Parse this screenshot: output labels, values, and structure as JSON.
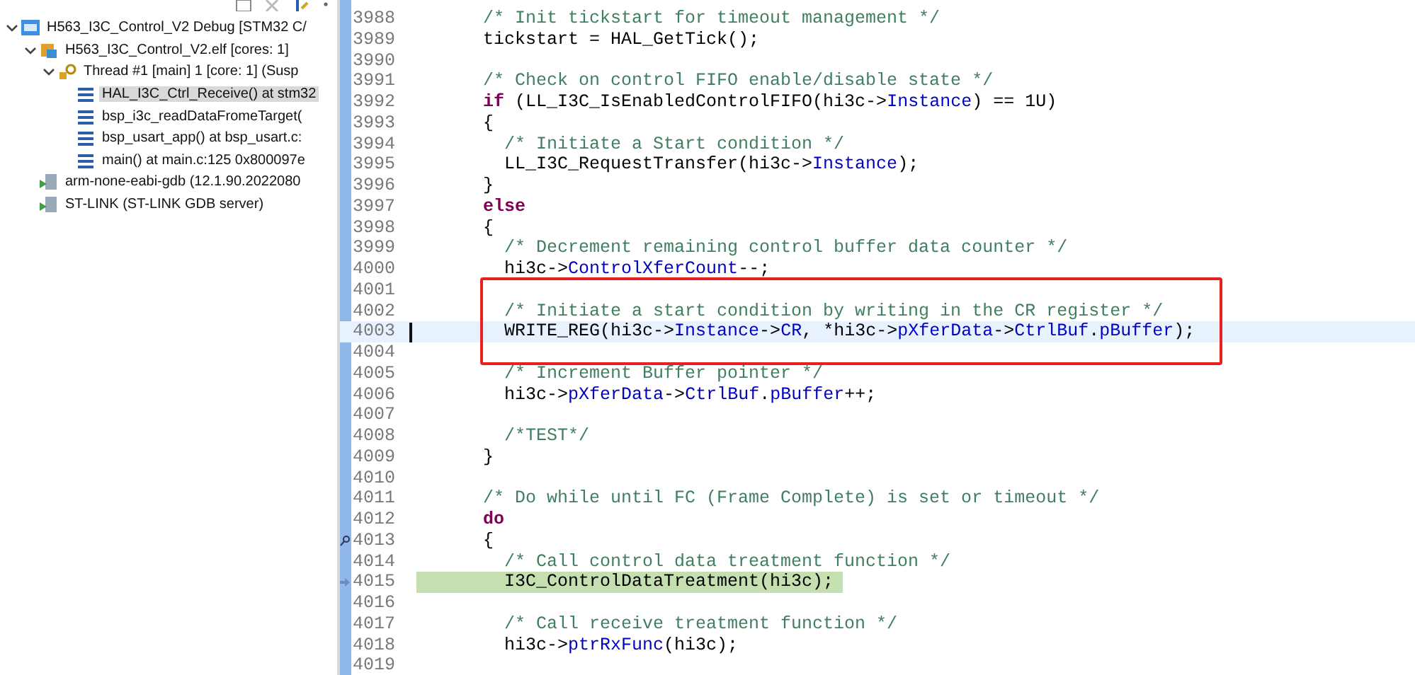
{
  "debug_view": {
    "tree": [
      {
        "kind": "launch",
        "label": "H563_I3C_Control_V2 Debug [STM32 C/",
        "expanded": true,
        "children": [
          {
            "kind": "elf",
            "label": "H563_I3C_Control_V2.elf [cores: 1]",
            "expanded": true,
            "children": [
              {
                "kind": "thread",
                "label": "Thread #1 [main] 1 [core: 1] (Susp",
                "expanded": true,
                "children": [
                  {
                    "kind": "frame",
                    "label": "HAL_I3C_Ctrl_Receive() at stm32",
                    "selected": true
                  },
                  {
                    "kind": "frame",
                    "label": "bsp_i3c_readDataFromeTarget(",
                    "selected": false
                  },
                  {
                    "kind": "frame",
                    "label": "bsp_usart_app() at bsp_usart.c:",
                    "selected": false
                  },
                  {
                    "kind": "frame",
                    "label": "main() at main.c:125 0x800097e",
                    "selected": false
                  }
                ]
              }
            ]
          },
          {
            "kind": "process",
            "label": "arm-none-eabi-gdb (12.1.90.2022080"
          },
          {
            "kind": "process",
            "label": "ST-LINK (ST-LINK GDB server)"
          }
        ]
      }
    ]
  },
  "editor": {
    "lines": [
      {
        "number": "3988",
        "segments": [
          {
            "kind": "comment",
            "text": "      /* Init tickstart for timeout management */"
          }
        ]
      },
      {
        "number": "3989",
        "segments": [
          {
            "kind": "plain",
            "text": "      tickstart = HAL_GetTick();"
          }
        ]
      },
      {
        "number": "3990"
      },
      {
        "number": "3991",
        "segments": [
          {
            "kind": "comment",
            "text": "      /* Check on control FIFO enable/disable state */"
          }
        ]
      },
      {
        "number": "3992",
        "segments": [
          {
            "kind": "keyword",
            "text": "      if"
          },
          {
            "kind": "plain",
            "text": " (LL_I3C_IsEnabledControlFIFO(hi3c->"
          },
          {
            "kind": "field",
            "text": "Instance"
          },
          {
            "kind": "plain",
            "text": ") == 1U)"
          }
        ]
      },
      {
        "number": "3993",
        "segments": [
          {
            "kind": "plain",
            "text": "      {"
          }
        ]
      },
      {
        "number": "3994",
        "segments": [
          {
            "kind": "comment",
            "text": "        /* Initiate a Start condition */"
          }
        ]
      },
      {
        "number": "3995",
        "segments": [
          {
            "kind": "plain",
            "text": "        LL_I3C_RequestTransfer(hi3c->"
          },
          {
            "kind": "field",
            "text": "Instance"
          },
          {
            "kind": "plain",
            "text": ");"
          }
        ]
      },
      {
        "number": "3996",
        "segments": [
          {
            "kind": "plain",
            "text": "      }"
          }
        ]
      },
      {
        "number": "3997",
        "segments": [
          {
            "kind": "keyword",
            "text": "      else"
          }
        ]
      },
      {
        "number": "3998",
        "segments": [
          {
            "kind": "plain",
            "text": "      {"
          }
        ]
      },
      {
        "number": "3999",
        "segments": [
          {
            "kind": "comment",
            "text": "        /* Decrement remaining control buffer data counter */"
          }
        ]
      },
      {
        "number": "4000",
        "segments": [
          {
            "kind": "plain",
            "text": "        hi3c->"
          },
          {
            "kind": "field",
            "text": "ControlXferCount"
          },
          {
            "kind": "plain",
            "text": "--;"
          }
        ]
      },
      {
        "number": "4001",
        "boxed": true
      },
      {
        "number": "4002",
        "boxed": true,
        "segments": [
          {
            "kind": "comment",
            "text": "        /* Initiate a start condition by writing in the CR register */"
          }
        ]
      },
      {
        "number": "4003",
        "boxed": true,
        "current_line": true,
        "segments": [
          {
            "kind": "plain",
            "text": "        WRITE_REG(hi3c->"
          },
          {
            "kind": "field",
            "text": "Instance"
          },
          {
            "kind": "plain",
            "text": "->"
          },
          {
            "kind": "field",
            "text": "CR"
          },
          {
            "kind": "plain",
            "text": ", *hi3c->"
          },
          {
            "kind": "field",
            "text": "pXferData"
          },
          {
            "kind": "plain",
            "text": "->"
          },
          {
            "kind": "field",
            "text": "CtrlBuf"
          },
          {
            "kind": "plain",
            "text": "."
          },
          {
            "kind": "field",
            "text": "pBuffer"
          },
          {
            "kind": "plain",
            "text": ");"
          }
        ]
      },
      {
        "number": "4004",
        "boxed": true
      },
      {
        "number": "4005",
        "segments": [
          {
            "kind": "comment",
            "text": "        /* Increment Buffer pointer */"
          }
        ]
      },
      {
        "number": "4006",
        "segments": [
          {
            "kind": "plain",
            "text": "        hi3c->"
          },
          {
            "kind": "field",
            "text": "pXferData"
          },
          {
            "kind": "plain",
            "text": "->"
          },
          {
            "kind": "field",
            "text": "CtrlBuf"
          },
          {
            "kind": "plain",
            "text": "."
          },
          {
            "kind": "field",
            "text": "pBuffer"
          },
          {
            "kind": "plain",
            "text": "++;"
          }
        ]
      },
      {
        "number": "4007"
      },
      {
        "number": "4008",
        "segments": [
          {
            "kind": "comment",
            "text": "        /*TEST*/"
          }
        ]
      },
      {
        "number": "4009",
        "segments": [
          {
            "kind": "plain",
            "text": "      }"
          }
        ]
      },
      {
        "number": "4010"
      },
      {
        "number": "4011",
        "segments": [
          {
            "kind": "comment",
            "text": "      /* Do while until FC (Frame Complete) is set or timeout */"
          }
        ]
      },
      {
        "number": "4012",
        "segments": [
          {
            "kind": "keyword",
            "text": "      do"
          }
        ]
      },
      {
        "number": "4013",
        "bookmark": true,
        "segments": [
          {
            "kind": "plain",
            "text": "      {"
          }
        ]
      },
      {
        "number": "4014",
        "segments": [
          {
            "kind": "comment",
            "text": "        /* Call control data treatment function */"
          }
        ]
      },
      {
        "number": "4015",
        "instruction_pointer": true,
        "segments": [
          {
            "kind": "plain",
            "text": "        I3C_ControlDataTreatment(hi3c);"
          }
        ]
      },
      {
        "number": "4016"
      },
      {
        "number": "4017",
        "segments": [
          {
            "kind": "comment",
            "text": "        /* Call receive treatment function */"
          }
        ]
      },
      {
        "number": "4018",
        "segments": [
          {
            "kind": "plain",
            "text": "        hi3c->"
          },
          {
            "kind": "field",
            "text": "ptrRxFunc"
          },
          {
            "kind": "plain",
            "text": "(hi3c);"
          }
        ]
      },
      {
        "number": "4019"
      }
    ]
  }
}
